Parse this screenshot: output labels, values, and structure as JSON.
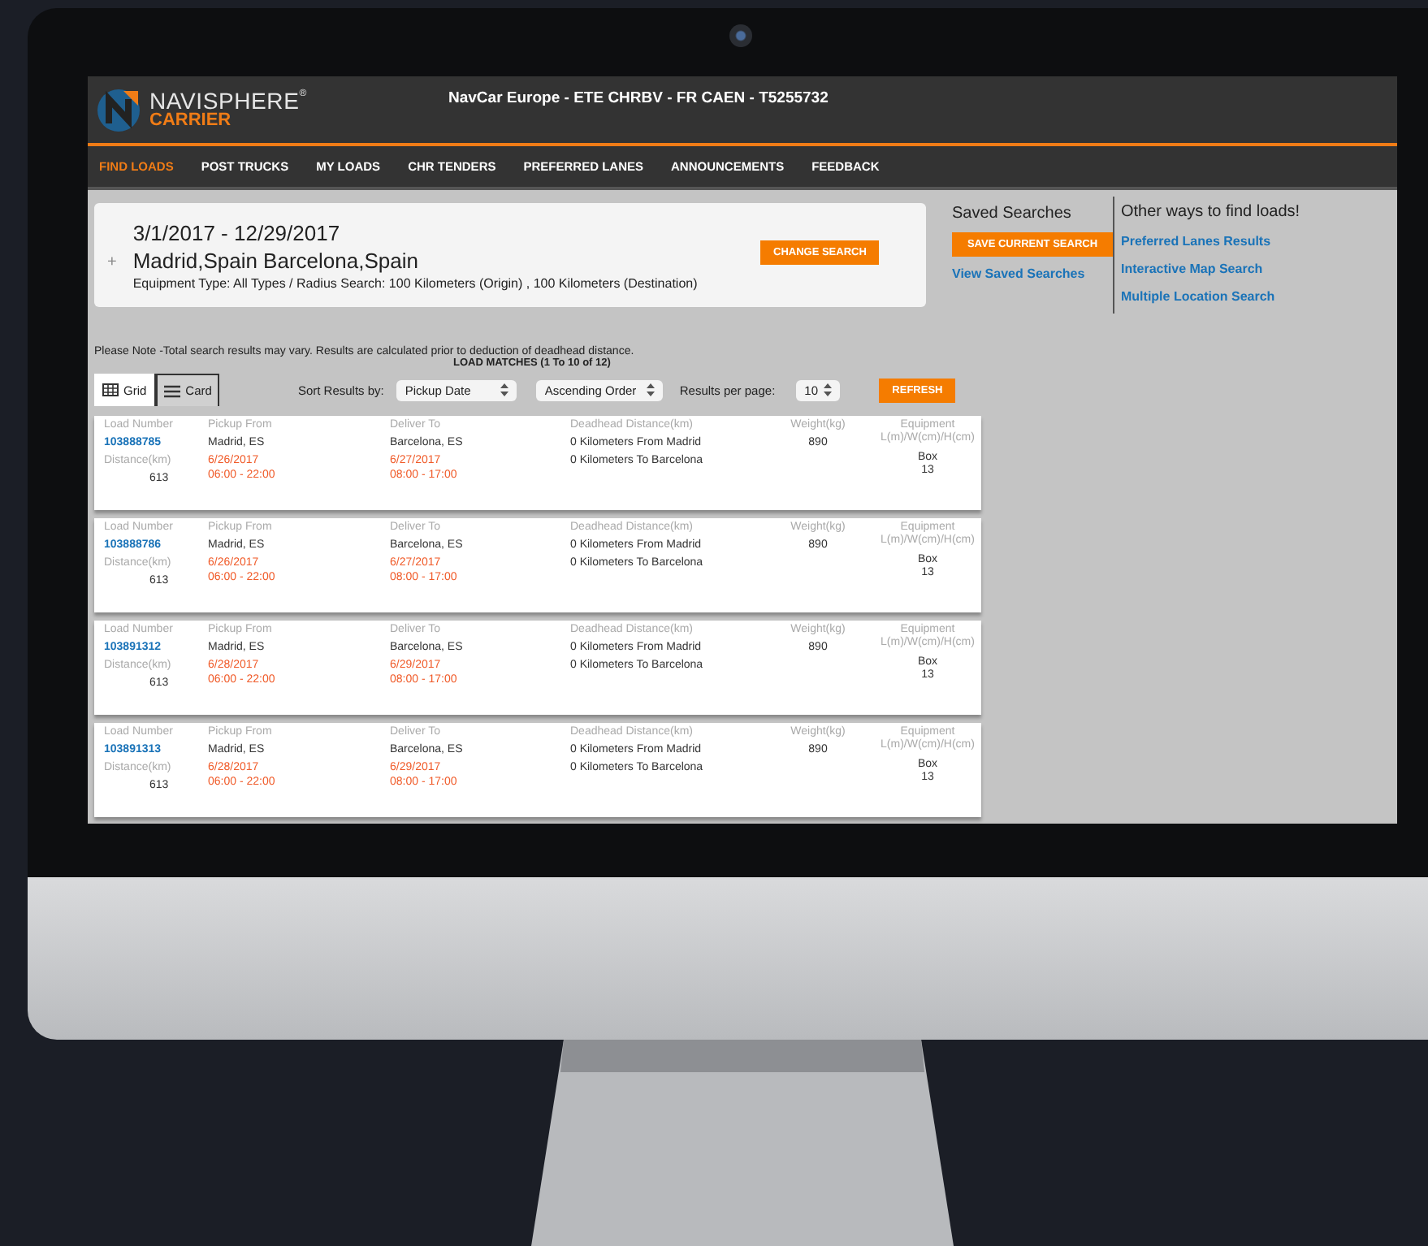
{
  "header": {
    "brand": "NAVISPHERE",
    "brand_mark": "®",
    "brand_sub": "CARRIER",
    "title": "NavCar Europe - ETE CHRBV - FR CAEN - T5255732"
  },
  "nav": [
    {
      "label": "FIND LOADS",
      "selected": true
    },
    {
      "label": "POST TRUCKS",
      "selected": false
    },
    {
      "label": "MY LOADS",
      "selected": false
    },
    {
      "label": "CHR TENDERS",
      "selected": false
    },
    {
      "label": "PREFERRED LANES",
      "selected": false
    },
    {
      "label": "ANNOUNCEMENTS",
      "selected": false
    },
    {
      "label": "FEEDBACK",
      "selected": false
    }
  ],
  "search": {
    "expand": "+",
    "dates": "3/1/2017 - 12/29/2017",
    "locations": "Madrid,Spain Barcelona,Spain",
    "equipment": "Equipment Type: All Types / Radius Search: 100 Kilometers (Origin) , 100 Kilometers (Destination)",
    "change_button": "CHANGE SEARCH"
  },
  "saved_searches": {
    "heading": "Saved Searches",
    "save_button": "SAVE CURRENT SEARCH",
    "view_link": "View Saved Searches"
  },
  "other_ways": {
    "heading": "Other ways to find loads!",
    "links": [
      "Preferred Lanes Results",
      "Interactive Map Search",
      "Multiple Location Search"
    ]
  },
  "note": "Please Note -Total search results may vary. Results are calculated prior to deduction of deadhead distance.",
  "matches": "LOAD MATCHES (1 To  10 of 12)",
  "view_toggle": [
    {
      "label": "Grid",
      "kind": "grid",
      "selected": false
    },
    {
      "label": "Card",
      "kind": "list",
      "selected": true
    }
  ],
  "sort": {
    "label": "Sort Results by:",
    "field": "Pickup Date",
    "order": "Ascending Order",
    "per_page_label": "Results per page:",
    "per_page": "10",
    "refresh": "REFRESH"
  },
  "loads": [
    {
      "load_number_label": "Load Number",
      "load_number": "103888785",
      "distance_label": "Distance(km)",
      "distance": "613",
      "pickup_label": "Pickup From",
      "pickup_city": "Madrid, ES",
      "pickup_date": "6/26/2017",
      "pickup_time": "06:00 - 22:00",
      "deliver_label": "Deliver To",
      "deliver_city": "Barcelona, ES",
      "deliver_date": "6/27/2017",
      "deliver_time": "08:00 - 17:00",
      "deadhead_label": "Deadhead Distance(km)",
      "deadhead_from": "0 Kilometers From Madrid",
      "deadhead_to": "0 Kilometers To Barcelona",
      "weight_label": "Weight(kg)",
      "weight": "890",
      "equipment_label": "Equipment",
      "equipment_dims": "L(m)/W(cm)/H(cm)",
      "equipment_type": "Box",
      "equipment_length": "13"
    },
    {
      "load_number_label": "Load Number",
      "load_number": "103888786",
      "distance_label": "Distance(km)",
      "distance": "613",
      "pickup_label": "Pickup From",
      "pickup_city": "Madrid, ES",
      "pickup_date": "6/26/2017",
      "pickup_time": "06:00 - 22:00",
      "deliver_label": "Deliver To",
      "deliver_city": "Barcelona, ES",
      "deliver_date": "6/27/2017",
      "deliver_time": "08:00 - 17:00",
      "deadhead_label": "Deadhead Distance(km)",
      "deadhead_from": "0 Kilometers From Madrid",
      "deadhead_to": "0 Kilometers To Barcelona",
      "weight_label": "Weight(kg)",
      "weight": "890",
      "equipment_label": "Equipment",
      "equipment_dims": "L(m)/W(cm)/H(cm)",
      "equipment_type": "Box",
      "equipment_length": "13"
    },
    {
      "load_number_label": "Load Number",
      "load_number": "103891312",
      "distance_label": "Distance(km)",
      "distance": "613",
      "pickup_label": "Pickup From",
      "pickup_city": "Madrid, ES",
      "pickup_date": "6/28/2017",
      "pickup_time": "06:00 - 22:00",
      "deliver_label": "Deliver To",
      "deliver_city": "Barcelona, ES",
      "deliver_date": "6/29/2017",
      "deliver_time": "08:00 - 17:00",
      "deadhead_label": "Deadhead Distance(km)",
      "deadhead_from": "0 Kilometers From Madrid",
      "deadhead_to": "0 Kilometers To Barcelona",
      "weight_label": "Weight(kg)",
      "weight": "890",
      "equipment_label": "Equipment",
      "equipment_dims": "L(m)/W(cm)/H(cm)",
      "equipment_type": "Box",
      "equipment_length": "13"
    },
    {
      "load_number_label": "Load Number",
      "load_number": "103891313",
      "distance_label": "Distance(km)",
      "distance": "613",
      "pickup_label": "Pickup From",
      "pickup_city": "Madrid, ES",
      "pickup_date": "6/28/2017",
      "pickup_time": "06:00 - 22:00",
      "deliver_label": "Deliver To",
      "deliver_city": "Barcelona, ES",
      "deliver_date": "6/29/2017",
      "deliver_time": "08:00 - 17:00",
      "deadhead_label": "Deadhead Distance(km)",
      "deadhead_from": "0 Kilometers From Madrid",
      "deadhead_to": "0 Kilometers To Barcelona",
      "weight_label": "Weight(kg)",
      "weight": "890",
      "equipment_label": "Equipment",
      "equipment_dims": "L(m)/W(cm)/H(cm)",
      "equipment_type": "Box",
      "equipment_length": "13"
    }
  ]
}
